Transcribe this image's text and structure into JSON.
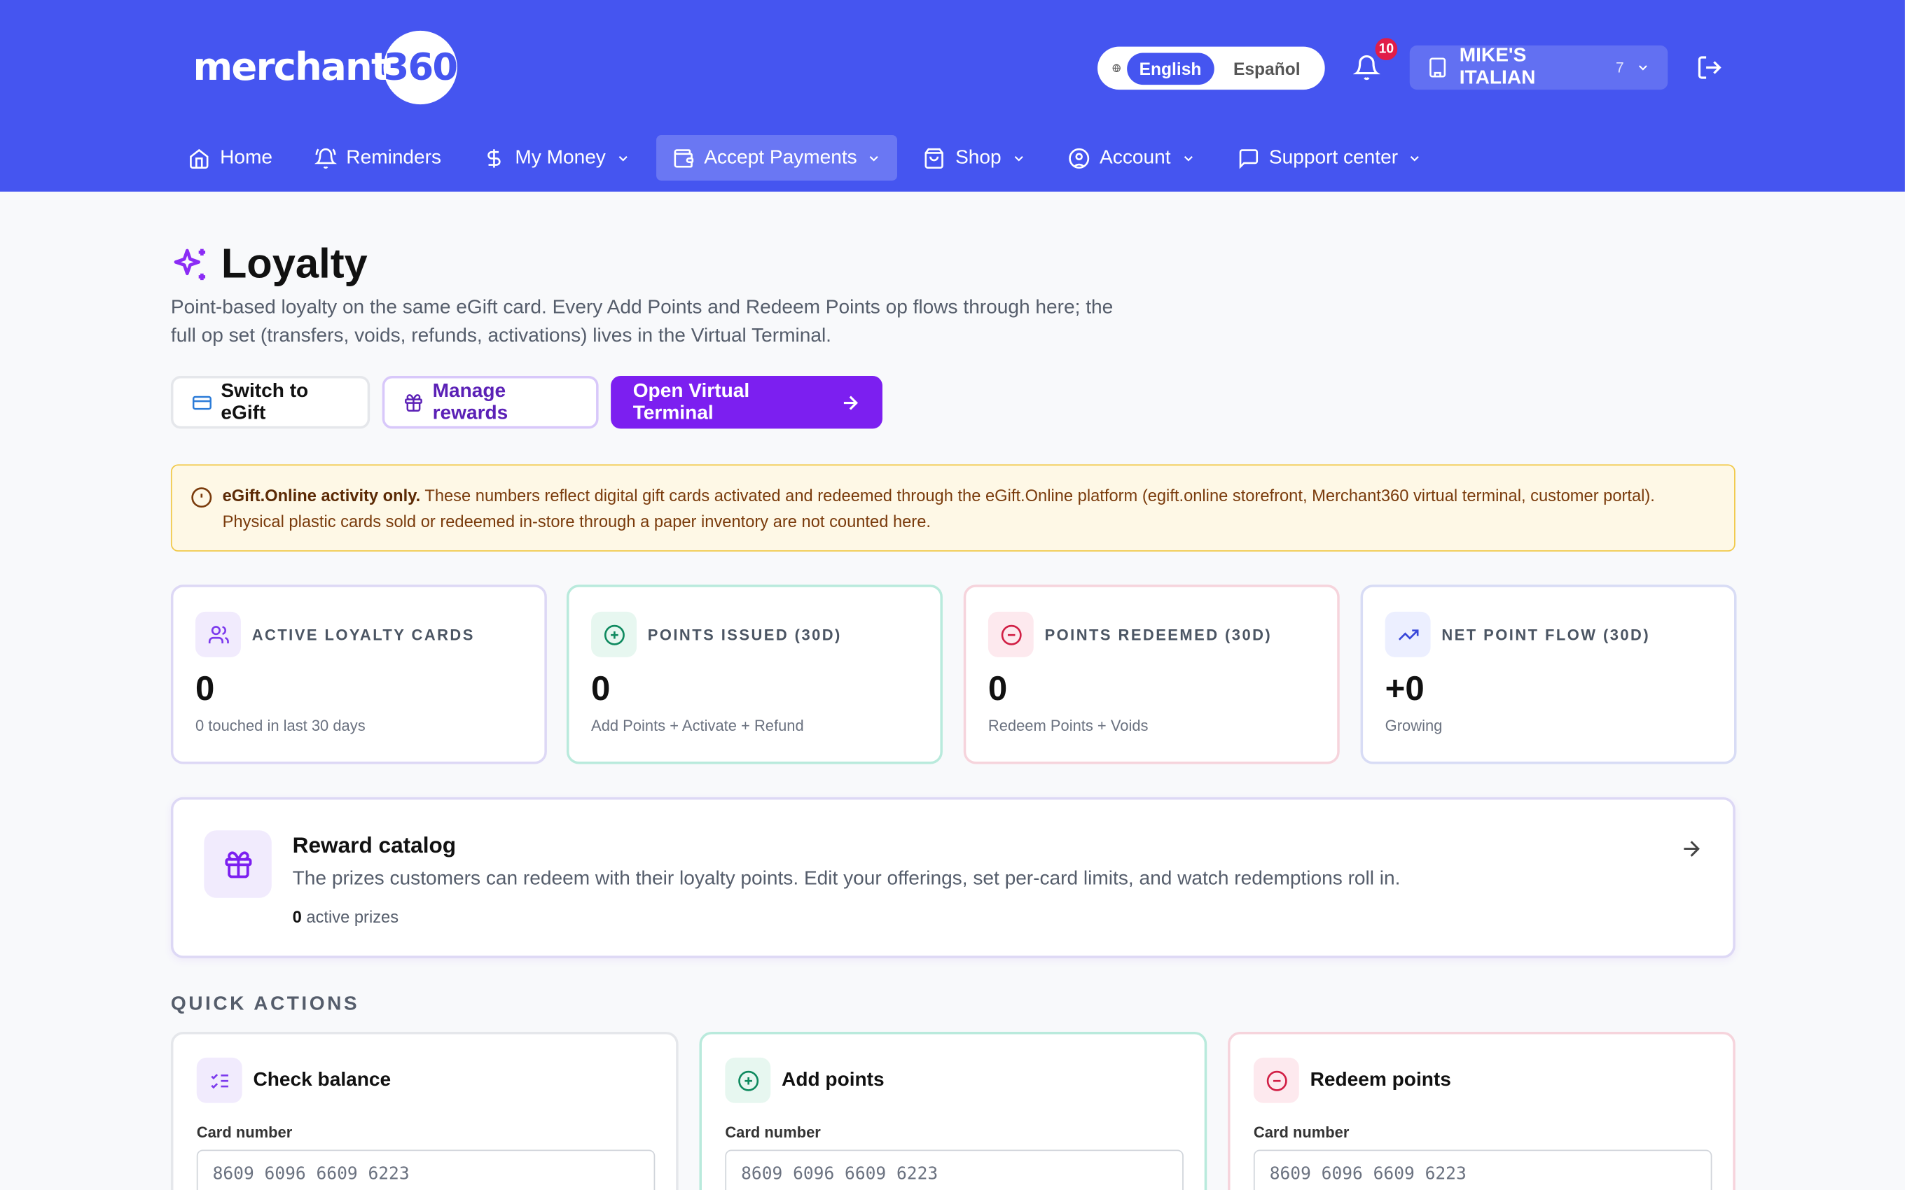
{
  "header": {
    "logo_text": "merchant",
    "logo_badge": "360",
    "language": {
      "active": "English",
      "other": "Español"
    },
    "notifications_count": "10",
    "store": {
      "name": "MIKE'S ITALIAN",
      "count": "7"
    }
  },
  "nav": [
    {
      "label": "Home",
      "icon": "home-icon",
      "dropdown": false
    },
    {
      "label": "Reminders",
      "icon": "bell-ring-icon",
      "dropdown": false
    },
    {
      "label": "My Money",
      "icon": "dollar-icon",
      "dropdown": true
    },
    {
      "label": "Accept Payments",
      "icon": "wallet-icon",
      "dropdown": true,
      "active": true
    },
    {
      "label": "Shop",
      "icon": "bag-icon",
      "dropdown": true
    },
    {
      "label": "Account",
      "icon": "user-circle-icon",
      "dropdown": true
    },
    {
      "label": "Support center",
      "icon": "chat-icon",
      "dropdown": true
    }
  ],
  "page": {
    "title": "Loyalty",
    "description": "Point-based loyalty on the same eGift card. Every Add Points and Redeem Points op flows through here; the full op set (transfers, voids, refunds, activations) lives in the Virtual Terminal.",
    "buttons": {
      "switch": "Switch to eGift",
      "manage": "Manage rewards",
      "terminal": "Open Virtual Terminal"
    },
    "notice": {
      "bold": "eGift.Online activity only.",
      "text": " These numbers reflect digital gift cards activated and redeemed through the eGift.Online platform (egift.online storefront, Merchant360 virtual terminal, customer portal). Physical plastic cards sold or redeemed in-store through a paper inventory are not counted here."
    }
  },
  "stats": [
    {
      "label": "ACTIVE LOYALTY CARDS",
      "value": "0",
      "sub": "0 touched in last 30 days",
      "icon": "users-icon"
    },
    {
      "label": "POINTS ISSUED (30D)",
      "value": "0",
      "sub": "Add Points + Activate + Refund",
      "icon": "plus-circle-icon"
    },
    {
      "label": "POINTS REDEEMED (30D)",
      "value": "0",
      "sub": "Redeem Points + Voids",
      "icon": "minus-circle-icon"
    },
    {
      "label": "NET POINT FLOW (30D)",
      "value": "+0",
      "sub": "Growing",
      "icon": "trend-up-icon"
    }
  ],
  "catalog": {
    "title": "Reward catalog",
    "description": "The prizes customers can redeem with their loyalty points. Edit your offerings, set per-card limits, and watch redemptions roll in.",
    "count": "0",
    "count_suffix": " active prizes"
  },
  "quick_actions": {
    "title": "QUICK ACTIONS",
    "cards": [
      {
        "title": "Check balance",
        "field_label": "Card number",
        "placeholder": "8609 6096 6609 6223"
      },
      {
        "title": "Add points",
        "field_label": "Card number",
        "placeholder": "8609 6096 6609 6223"
      },
      {
        "title": "Redeem points",
        "field_label": "Card number",
        "placeholder": "8609 6096 6609 6223"
      }
    ]
  },
  "colors": {
    "header_bg": "#4555f0",
    "primary_purple": "#7c1ff0",
    "notice_bg": "#fef8e6",
    "notice_border": "#f1c94a"
  }
}
